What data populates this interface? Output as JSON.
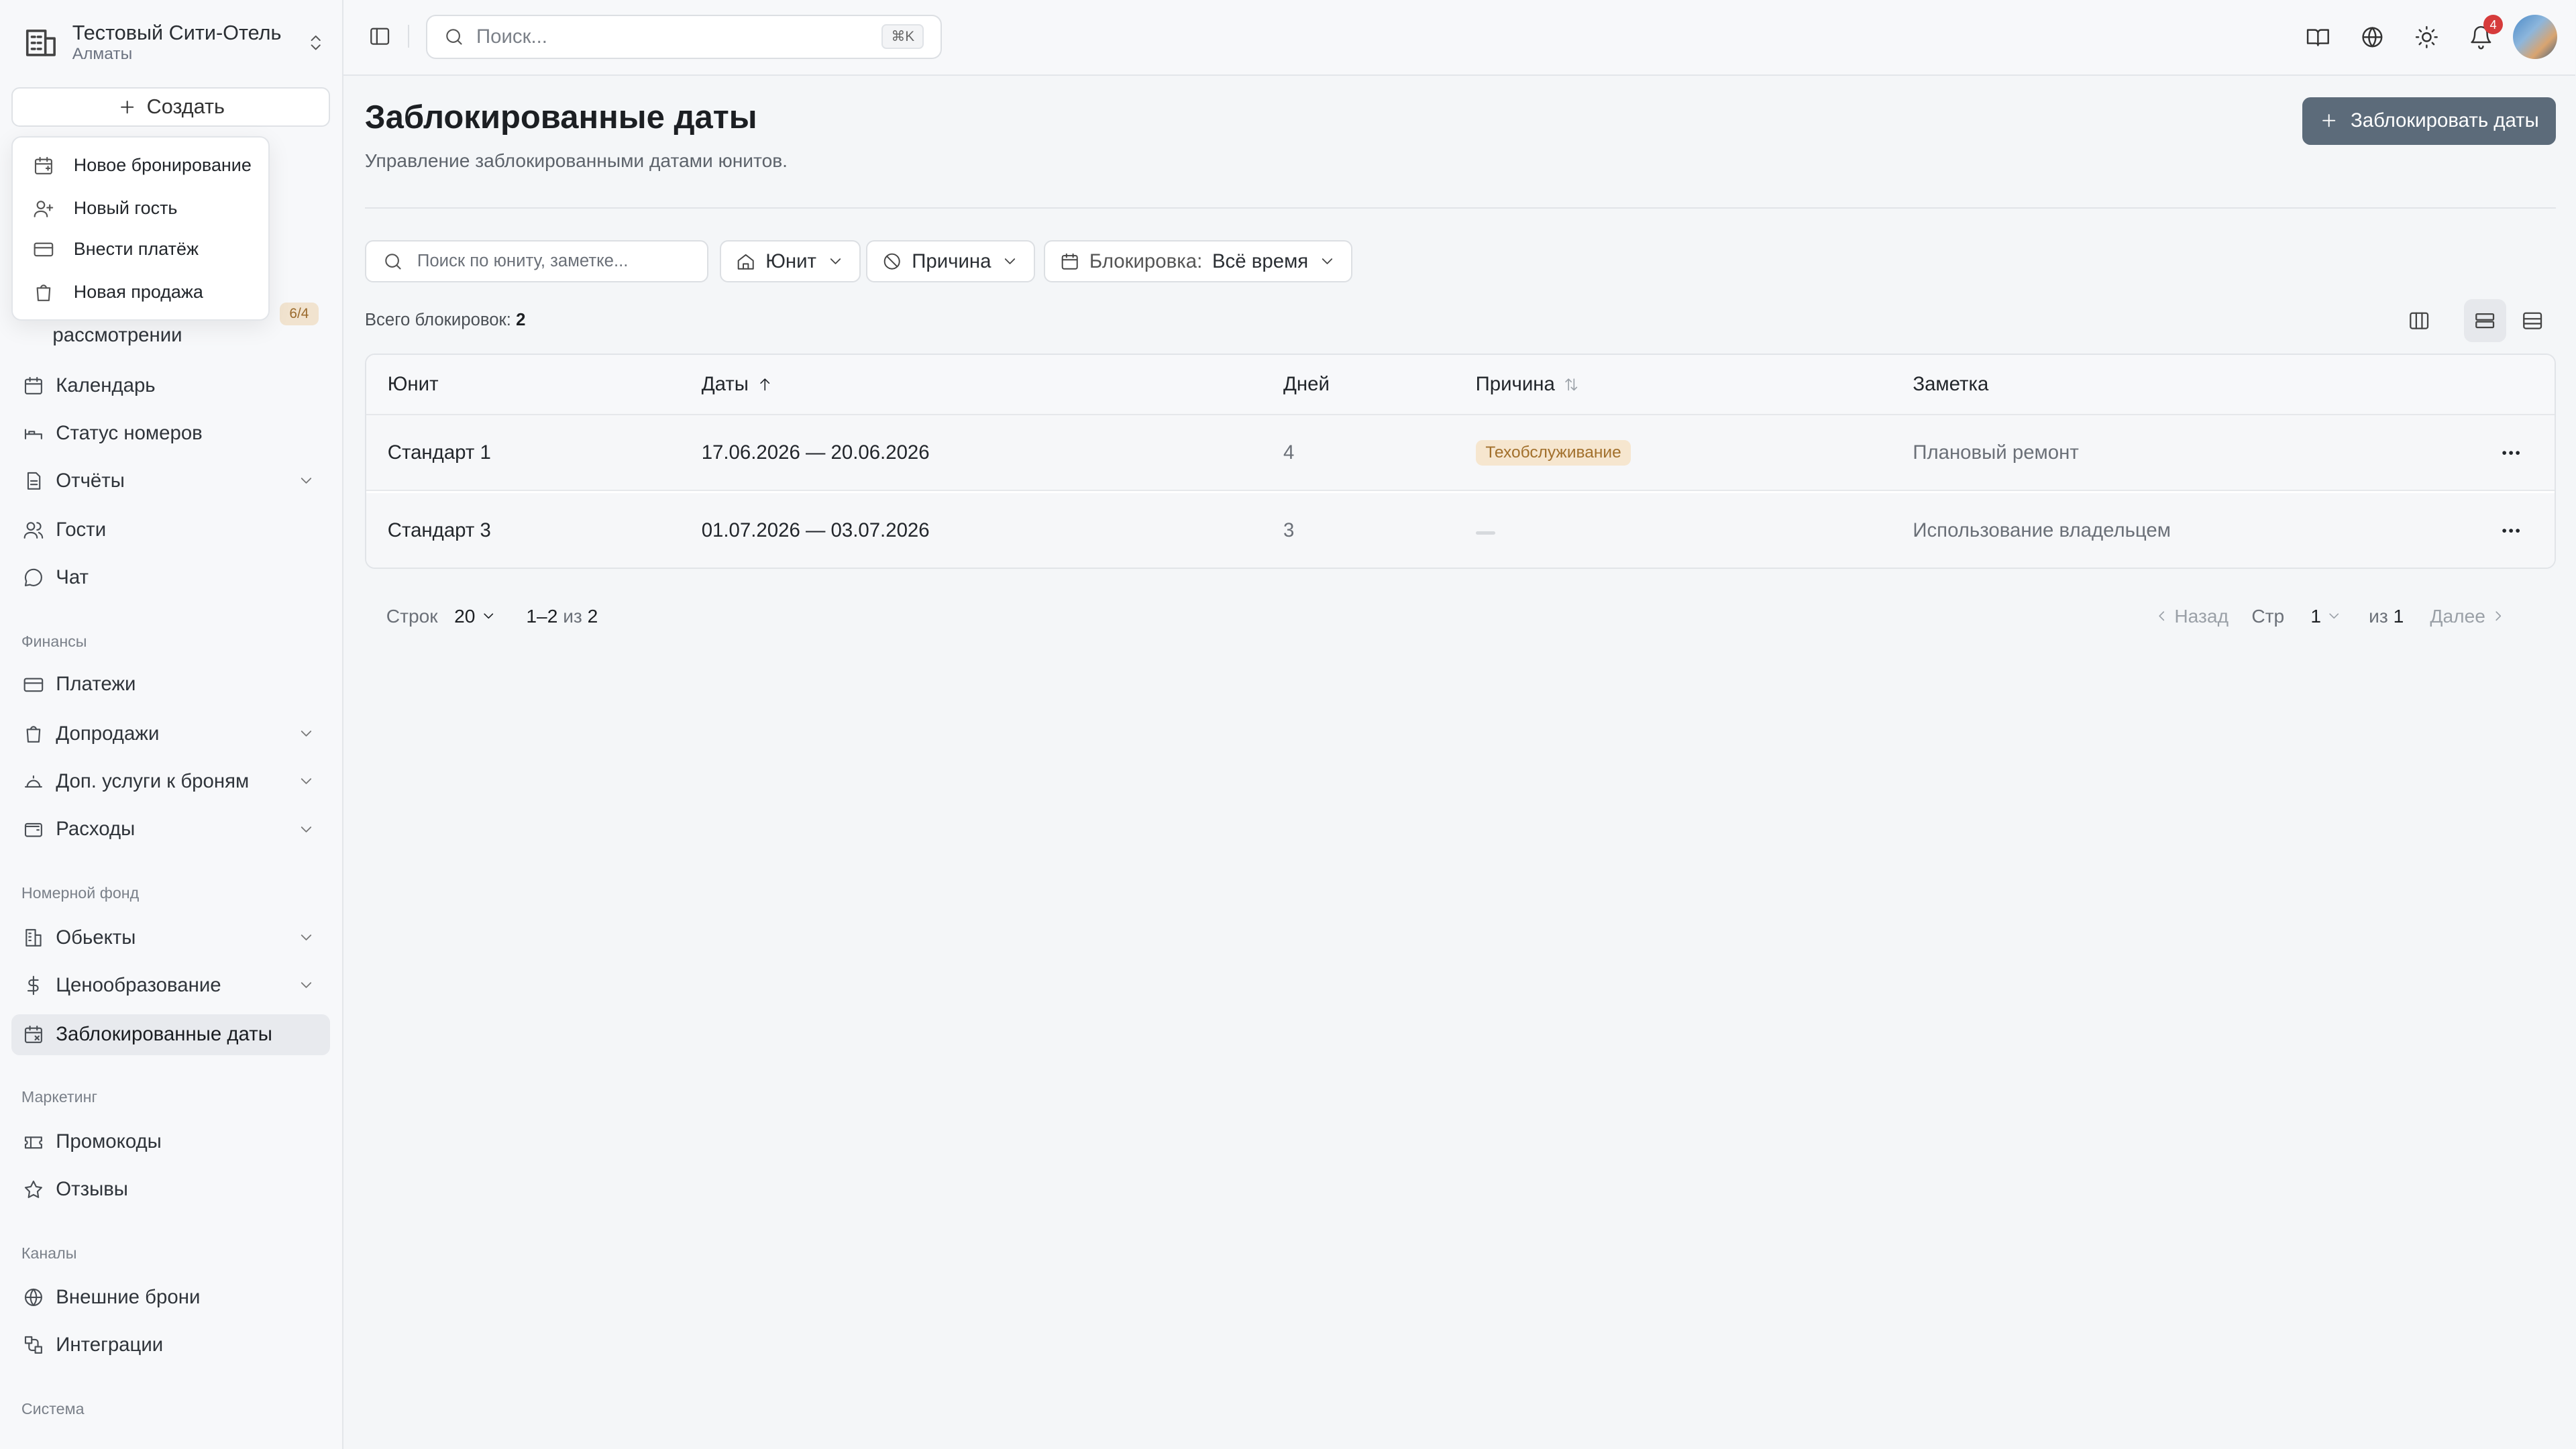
{
  "hotel": {
    "name": "Тестовый Сити-Отель",
    "city": "Алматы"
  },
  "sidebar": {
    "create_label": "Создать",
    "pending_badge": "6/4",
    "pending_label": "рассмотрении",
    "items_top": [
      {
        "label": "Календарь",
        "icon": "calendar-icon"
      },
      {
        "label": "Статус номеров",
        "icon": "bed-icon"
      },
      {
        "label": "Отчёты",
        "icon": "document-icon",
        "expandable": true
      },
      {
        "label": "Гости",
        "icon": "users-icon"
      },
      {
        "label": "Чат",
        "icon": "chat-icon"
      }
    ],
    "section_finance": "Финансы",
    "items_finance": [
      {
        "label": "Платежи",
        "icon": "card-icon"
      },
      {
        "label": "Допродажи",
        "icon": "bag-icon",
        "expandable": true
      },
      {
        "label": "Доп. услуги к броням",
        "icon": "bell-service-icon",
        "expandable": true
      },
      {
        "label": "Расходы",
        "icon": "wallet-icon",
        "expandable": true
      }
    ],
    "section_rooms": "Номерной фонд",
    "items_rooms": [
      {
        "label": "Обьекты",
        "icon": "building-icon",
        "expandable": true
      },
      {
        "label": "Ценообразование",
        "icon": "dollar-icon",
        "expandable": true
      },
      {
        "label": "Заблокированные даты",
        "icon": "calendar-block-icon",
        "active": true
      }
    ],
    "section_marketing": "Маркетинг",
    "items_marketing": [
      {
        "label": "Промокоды",
        "icon": "ticket-icon"
      },
      {
        "label": "Отзывы",
        "icon": "star-icon"
      }
    ],
    "section_channels": "Каналы",
    "items_channels": [
      {
        "label": "Внешние брони",
        "icon": "globe-icon"
      },
      {
        "label": "Интеграции",
        "icon": "integration-icon"
      }
    ],
    "section_system": "Система"
  },
  "create_menu": [
    {
      "label": "Новое бронирование",
      "icon": "calendar-plus-icon"
    },
    {
      "label": "Новый гость",
      "icon": "user-plus-icon"
    },
    {
      "label": "Внести платёж",
      "icon": "card-icon"
    },
    {
      "label": "Новая продажа",
      "icon": "bag-icon"
    }
  ],
  "topbar": {
    "search_placeholder": "Поиск...",
    "search_shortcut": "⌘K",
    "notification_count": "4"
  },
  "page": {
    "title": "Заблокированные даты",
    "subtitle": "Управление заблокированными датами юнитов.",
    "block_button": "Заблокировать даты"
  },
  "filters": {
    "search_placeholder": "Поиск по юниту, заметке...",
    "unit": "Юнит",
    "reason": "Причина",
    "period_prefix": "Блокировка:",
    "period_value": "Всё время"
  },
  "summary": {
    "label": "Всего блокировок:",
    "count": "2"
  },
  "table": {
    "columns": [
      "Юнит",
      "Даты",
      "Дней",
      "Причина",
      "Заметка"
    ],
    "rows": [
      {
        "unit": "Стандарт 1",
        "dates": "17.06.2026 — 20.06.2026",
        "days": "4",
        "reason": "Техобслуживание",
        "note": "Плановый ремонт"
      },
      {
        "unit": "Стандарт 3",
        "dates": "01.07.2026 — 03.07.2026",
        "days": "3",
        "reason": "",
        "note": "Использование владельцем"
      }
    ]
  },
  "pagination": {
    "rows_label": "Строк",
    "rows_value": "20",
    "range_from": "1",
    "range_to": "2",
    "of_label": "из",
    "total": "2",
    "prev": "Назад",
    "page_label": "Стр",
    "page_value": "1",
    "page_of_label": "из",
    "page_total": "1",
    "next": "Далее"
  }
}
